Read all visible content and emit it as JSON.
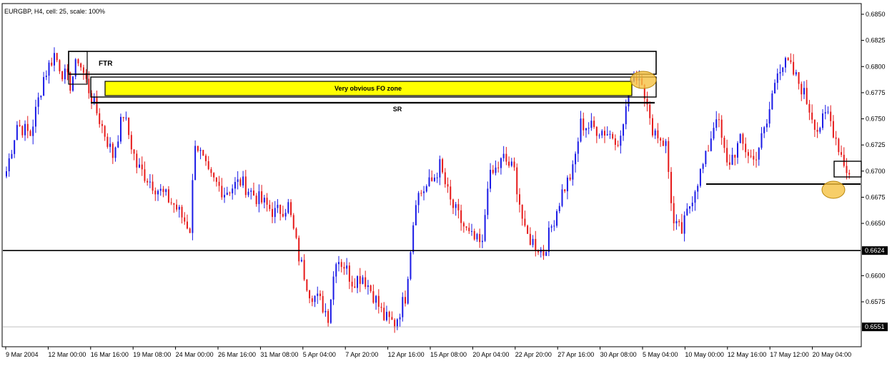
{
  "header": {
    "title": "EURGBP, H4, cell: 25, scale: 100%"
  },
  "colors": {
    "bull": "#1a1ae6",
    "bear": "#e61a1a",
    "zone_fill": "#ffff00",
    "highlight": "#f5c242",
    "line": "#000000"
  },
  "chart_data": {
    "type": "candlestick",
    "symbol": "EURGBP",
    "timeframe": "H4",
    "ylim": [
      0.6535,
      0.6862
    ],
    "y_ticks": [
      "0.6850",
      "0.6825",
      "0.6800",
      "0.6775",
      "0.6750",
      "0.6725",
      "0.6700",
      "0.6675",
      "0.6650",
      "0.6600",
      "0.6575"
    ],
    "x_ticks": [
      "9 Mar 2004",
      "12 Mar 00:00",
      "16 Mar 16:00",
      "19 Mar 08:00",
      "24 Mar 00:00",
      "26 Mar 16:00",
      "31 Mar 08:00",
      "5 Apr 04:00",
      "7 Apr 20:00",
      "12 Apr 16:00",
      "15 Apr 08:00",
      "20 Apr 04:00",
      "22 Apr 20:00",
      "27 Apr 16:00",
      "30 Apr 08:00",
      "5 May 04:00",
      "10 May 00:00",
      "12 May 16:00",
      "17 May 12:00",
      "20 May 04:00"
    ],
    "x_tick_index": [
      0,
      16,
      32,
      48,
      64,
      80,
      96,
      112,
      128,
      144,
      160,
      176,
      192,
      208,
      224,
      240,
      256,
      272,
      288,
      304
    ],
    "candle_count": 318,
    "close_path": [
      [
        0,
        0.67
      ],
      [
        4,
        0.6745
      ],
      [
        9,
        0.6735
      ],
      [
        14,
        0.679
      ],
      [
        18,
        0.6812
      ],
      [
        21,
        0.6795
      ],
      [
        24,
        0.6783
      ],
      [
        27,
        0.6808
      ],
      [
        33,
        0.6763
      ],
      [
        40,
        0.6715
      ],
      [
        44,
        0.6755
      ],
      [
        49,
        0.6705
      ],
      [
        56,
        0.6685
      ],
      [
        63,
        0.6668
      ],
      [
        69,
        0.6645
      ],
      [
        71,
        0.673
      ],
      [
        76,
        0.6695
      ],
      [
        82,
        0.668
      ],
      [
        88,
        0.669
      ],
      [
        94,
        0.6675
      ],
      [
        101,
        0.666
      ],
      [
        106,
        0.6667
      ],
      [
        110,
        0.6618
      ],
      [
        114,
        0.6585
      ],
      [
        118,
        0.6575
      ],
      [
        121,
        0.6562
      ],
      [
        124,
        0.6618
      ],
      [
        127,
        0.661
      ],
      [
        130,
        0.6595
      ],
      [
        134,
        0.66
      ],
      [
        138,
        0.6582
      ],
      [
        142,
        0.656
      ],
      [
        146,
        0.6554
      ],
      [
        150,
        0.658
      ],
      [
        154,
        0.6675
      ],
      [
        160,
        0.669
      ],
      [
        163,
        0.6705
      ],
      [
        167,
        0.667
      ],
      [
        174,
        0.6638
      ],
      [
        179,
        0.6628
      ],
      [
        181,
        0.669
      ],
      [
        187,
        0.6712
      ],
      [
        191,
        0.67
      ],
      [
        195,
        0.664
      ],
      [
        202,
        0.6622
      ],
      [
        209,
        0.668
      ],
      [
        213,
        0.67
      ],
      [
        216,
        0.6745
      ],
      [
        225,
        0.6738
      ],
      [
        231,
        0.673
      ],
      [
        235,
        0.6792
      ],
      [
        239,
        0.679
      ],
      [
        242,
        0.6745
      ],
      [
        248,
        0.6725
      ],
      [
        251,
        0.6648
      ],
      [
        254,
        0.6642
      ],
      [
        259,
        0.6685
      ],
      [
        263,
        0.6712
      ],
      [
        267,
        0.6755
      ],
      [
        271,
        0.6705
      ],
      [
        276,
        0.6728
      ],
      [
        281,
        0.671
      ],
      [
        286,
        0.6745
      ],
      [
        290,
        0.68
      ],
      [
        294,
        0.6802
      ],
      [
        299,
        0.678
      ],
      [
        305,
        0.674
      ],
      [
        309,
        0.6755
      ],
      [
        315,
        0.6708
      ],
      [
        319,
        0.6685
      ],
      [
        323,
        0.67
      ],
      [
        327,
        0.6675
      ]
    ],
    "ranges": {
      "high": 0.6838,
      "low": 0.6551
    },
    "horizontal_lines": [
      0.6624,
      0.6551
    ],
    "price_boxes": [
      "0.6624",
      "0.6551"
    ],
    "annotations": [
      {
        "label": "FTR",
        "type": "box"
      },
      {
        "label": "Very obvious FO zone",
        "type": "filled-box"
      },
      {
        "label": "SR",
        "type": "line"
      }
    ]
  }
}
